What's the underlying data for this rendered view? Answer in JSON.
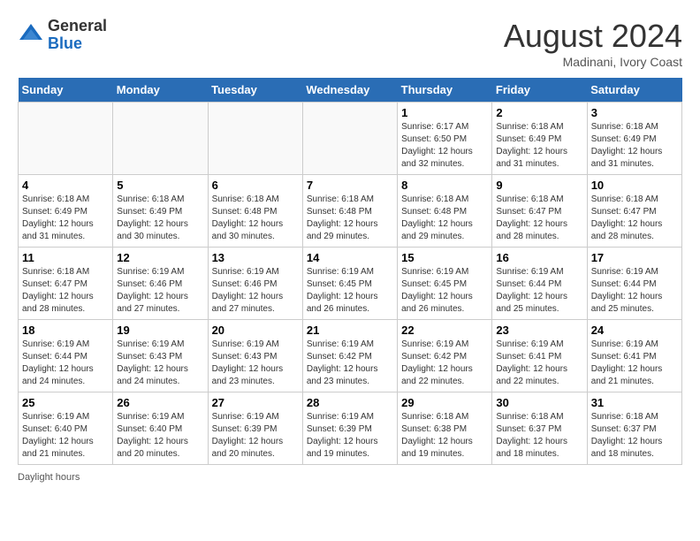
{
  "header": {
    "logo_general": "General",
    "logo_blue": "Blue",
    "month_year": "August 2024",
    "location": "Madinani, Ivory Coast"
  },
  "days_of_week": [
    "Sunday",
    "Monday",
    "Tuesday",
    "Wednesday",
    "Thursday",
    "Friday",
    "Saturday"
  ],
  "footnote": "Daylight hours",
  "weeks": [
    [
      {
        "day": "",
        "info": ""
      },
      {
        "day": "",
        "info": ""
      },
      {
        "day": "",
        "info": ""
      },
      {
        "day": "",
        "info": ""
      },
      {
        "day": "1",
        "info": "Sunrise: 6:17 AM\nSunset: 6:50 PM\nDaylight: 12 hours\nand 32 minutes."
      },
      {
        "day": "2",
        "info": "Sunrise: 6:18 AM\nSunset: 6:49 PM\nDaylight: 12 hours\nand 31 minutes."
      },
      {
        "day": "3",
        "info": "Sunrise: 6:18 AM\nSunset: 6:49 PM\nDaylight: 12 hours\nand 31 minutes."
      }
    ],
    [
      {
        "day": "4",
        "info": "Sunrise: 6:18 AM\nSunset: 6:49 PM\nDaylight: 12 hours\nand 31 minutes."
      },
      {
        "day": "5",
        "info": "Sunrise: 6:18 AM\nSunset: 6:49 PM\nDaylight: 12 hours\nand 30 minutes."
      },
      {
        "day": "6",
        "info": "Sunrise: 6:18 AM\nSunset: 6:48 PM\nDaylight: 12 hours\nand 30 minutes."
      },
      {
        "day": "7",
        "info": "Sunrise: 6:18 AM\nSunset: 6:48 PM\nDaylight: 12 hours\nand 29 minutes."
      },
      {
        "day": "8",
        "info": "Sunrise: 6:18 AM\nSunset: 6:48 PM\nDaylight: 12 hours\nand 29 minutes."
      },
      {
        "day": "9",
        "info": "Sunrise: 6:18 AM\nSunset: 6:47 PM\nDaylight: 12 hours\nand 28 minutes."
      },
      {
        "day": "10",
        "info": "Sunrise: 6:18 AM\nSunset: 6:47 PM\nDaylight: 12 hours\nand 28 minutes."
      }
    ],
    [
      {
        "day": "11",
        "info": "Sunrise: 6:18 AM\nSunset: 6:47 PM\nDaylight: 12 hours\nand 28 minutes."
      },
      {
        "day": "12",
        "info": "Sunrise: 6:19 AM\nSunset: 6:46 PM\nDaylight: 12 hours\nand 27 minutes."
      },
      {
        "day": "13",
        "info": "Sunrise: 6:19 AM\nSunset: 6:46 PM\nDaylight: 12 hours\nand 27 minutes."
      },
      {
        "day": "14",
        "info": "Sunrise: 6:19 AM\nSunset: 6:45 PM\nDaylight: 12 hours\nand 26 minutes."
      },
      {
        "day": "15",
        "info": "Sunrise: 6:19 AM\nSunset: 6:45 PM\nDaylight: 12 hours\nand 26 minutes."
      },
      {
        "day": "16",
        "info": "Sunrise: 6:19 AM\nSunset: 6:44 PM\nDaylight: 12 hours\nand 25 minutes."
      },
      {
        "day": "17",
        "info": "Sunrise: 6:19 AM\nSunset: 6:44 PM\nDaylight: 12 hours\nand 25 minutes."
      }
    ],
    [
      {
        "day": "18",
        "info": "Sunrise: 6:19 AM\nSunset: 6:44 PM\nDaylight: 12 hours\nand 24 minutes."
      },
      {
        "day": "19",
        "info": "Sunrise: 6:19 AM\nSunset: 6:43 PM\nDaylight: 12 hours\nand 24 minutes."
      },
      {
        "day": "20",
        "info": "Sunrise: 6:19 AM\nSunset: 6:43 PM\nDaylight: 12 hours\nand 23 minutes."
      },
      {
        "day": "21",
        "info": "Sunrise: 6:19 AM\nSunset: 6:42 PM\nDaylight: 12 hours\nand 23 minutes."
      },
      {
        "day": "22",
        "info": "Sunrise: 6:19 AM\nSunset: 6:42 PM\nDaylight: 12 hours\nand 22 minutes."
      },
      {
        "day": "23",
        "info": "Sunrise: 6:19 AM\nSunset: 6:41 PM\nDaylight: 12 hours\nand 22 minutes."
      },
      {
        "day": "24",
        "info": "Sunrise: 6:19 AM\nSunset: 6:41 PM\nDaylight: 12 hours\nand 21 minutes."
      }
    ],
    [
      {
        "day": "25",
        "info": "Sunrise: 6:19 AM\nSunset: 6:40 PM\nDaylight: 12 hours\nand 21 minutes."
      },
      {
        "day": "26",
        "info": "Sunrise: 6:19 AM\nSunset: 6:40 PM\nDaylight: 12 hours\nand 20 minutes."
      },
      {
        "day": "27",
        "info": "Sunrise: 6:19 AM\nSunset: 6:39 PM\nDaylight: 12 hours\nand 20 minutes."
      },
      {
        "day": "28",
        "info": "Sunrise: 6:19 AM\nSunset: 6:39 PM\nDaylight: 12 hours\nand 19 minutes."
      },
      {
        "day": "29",
        "info": "Sunrise: 6:18 AM\nSunset: 6:38 PM\nDaylight: 12 hours\nand 19 minutes."
      },
      {
        "day": "30",
        "info": "Sunrise: 6:18 AM\nSunset: 6:37 PM\nDaylight: 12 hours\nand 18 minutes."
      },
      {
        "day": "31",
        "info": "Sunrise: 6:18 AM\nSunset: 6:37 PM\nDaylight: 12 hours\nand 18 minutes."
      }
    ]
  ]
}
